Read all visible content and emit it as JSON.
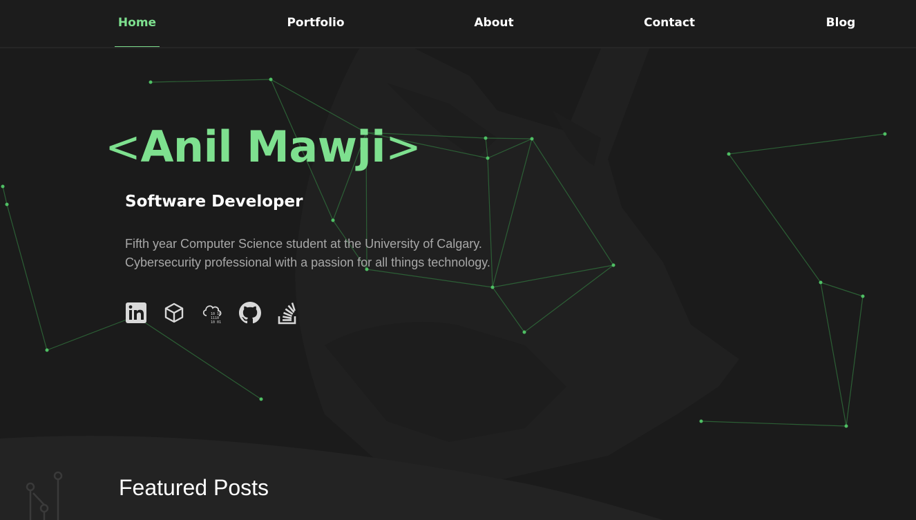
{
  "nav": {
    "items": [
      {
        "label": "Home",
        "active": true
      },
      {
        "label": "Portfolio",
        "active": false
      },
      {
        "label": "About",
        "active": false
      },
      {
        "label": "Contact",
        "active": false
      },
      {
        "label": "Blog",
        "active": false
      }
    ]
  },
  "hero": {
    "name": "Anil Mawji",
    "bracket_open": "<",
    "bracket_close": ">",
    "role": "Software Developer",
    "description_line1": "Fifth year Computer Science student at the University of Calgary.",
    "description_line2": "Cybersecurity professional with a passion for all things technology."
  },
  "socials": [
    {
      "icon": "linkedin-icon"
    },
    {
      "icon": "cube-icon"
    },
    {
      "icon": "cloud-binary-icon"
    },
    {
      "icon": "github-icon"
    },
    {
      "icon": "stackoverflow-icon"
    }
  ],
  "featured": {
    "title": "Featured Posts"
  },
  "colors": {
    "accent": "#7ee08f",
    "background": "#1b1b1b",
    "nav_background": "#1c1c1c",
    "section_background": "#232323",
    "muted_text": "#a8a8a8"
  }
}
